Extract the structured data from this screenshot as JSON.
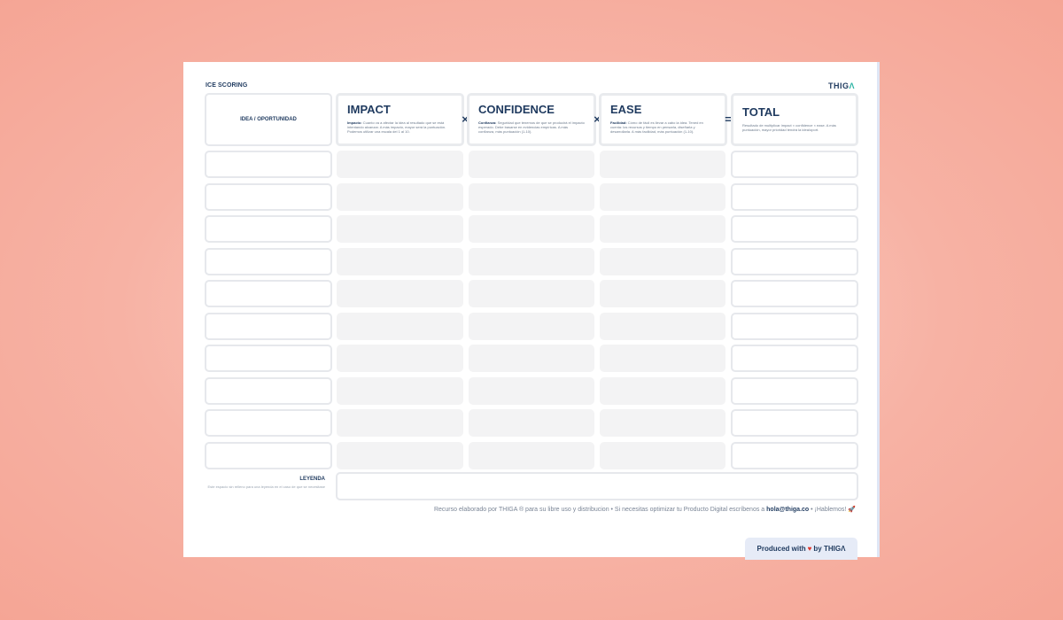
{
  "board": {
    "title": "ICE SCORING",
    "logo": {
      "main": "THIG",
      "accent": "Λ"
    },
    "idea_header": "IDEA / OPORTUNIDAD",
    "columns": [
      {
        "title": "IMPACT",
        "desc_bold": "Impacto:",
        "desc": " Cuanto va a afectar la idea al resultado que se está intentando alcanzar. A más impacto, mayor será la puntuación. Podemos utilizar una escala del 1 al 10."
      },
      {
        "title": "CONFIDENCE",
        "desc_bold": "Confianza:",
        "desc": " Seguridad que tenemos de que se producirá el impacto esperado. Debe basarse en evidencias empíricas. A más confianza, más puntuación (1-10)."
      },
      {
        "title": "EASE",
        "desc_bold": "Facilidad:",
        "desc": " Cómo de fácil es llevar a cabo la idea. Tened en cuenta: los recursos y tiempo en pensarla, diseñarla y desarrollarla. A más facilidad, más puntuación (1-10)."
      }
    ],
    "operators": [
      "×",
      "×",
      "="
    ],
    "total": {
      "title": "TOTAL",
      "desc": "Resultado de multiplicar impact × confidence × ease. A más puntuación, mayor prioridad tendrá la idea/oport."
    },
    "row_count": 10,
    "leyenda": {
      "title": "LEYENDA",
      "subtitle": "Este espacio sin relleno para una leyenda en el caso de que se necesitase"
    },
    "footer": {
      "text": "Recurso elaborado por THIGA ® para su libre uso y distribucion  •  Si necesitas optimizar tu Producto Digital escríbenos a ",
      "email": "hola@thiga.co",
      "tail": "  •  ¡Hablemos! 🚀"
    },
    "produced": {
      "prefix": "Produced with",
      "heart": "♥",
      "suffix": "by THIGΛ"
    }
  }
}
